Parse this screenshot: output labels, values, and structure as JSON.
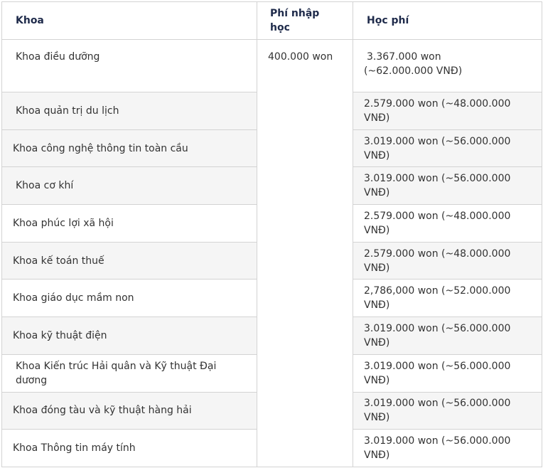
{
  "headers": {
    "khoa": "Khoa",
    "phi_nhap_hoc": "Phí nhập học",
    "hoc_phi": "Học phí"
  },
  "admission_fee": "400.000 won",
  "rows": [
    {
      "khoa": "Khoa điều dưỡng",
      "hoc_phi": "3.367.000 won",
      "hoc_phi_2": "(~62.000.000 VNĐ)"
    },
    {
      "khoa": "Khoa quản trị du lịch",
      "hoc_phi": "2.579.000 won (~48.000.000 VNĐ)"
    },
    {
      "khoa": "Khoa công nghệ thông tin toàn cầu",
      "hoc_phi": "3.019.000 won (~56.000.000 VNĐ)"
    },
    {
      "khoa": "Khoa cơ khí",
      "hoc_phi": "3.019.000 won (~56.000.000 VNĐ)"
    },
    {
      "khoa": "Khoa phúc lợi xã hội",
      "hoc_phi": "2.579.000 won (~48.000.000 VNĐ)"
    },
    {
      "khoa": "Khoa kế toán thuế",
      "hoc_phi": "2.579.000 won (~48.000.000 VNĐ)"
    },
    {
      "khoa": "Khoa giáo dục mầm non",
      "hoc_phi": "2,786,000 won (~52.000.000 VNĐ)"
    },
    {
      "khoa": "Khoa kỹ thuật điện",
      "hoc_phi": "3.019.000 won (~56.000.000 VNĐ)"
    },
    {
      "khoa": "Khoa Kiến trúc Hải quân và Kỹ thuật Đại dương",
      "hoc_phi": "3.019.000 won (~56.000.000 VNĐ)"
    },
    {
      "khoa": "Khoa đóng tàu và kỹ thuật hàng hải",
      "hoc_phi": "3.019.000 won (~56.000.000 VNĐ)"
    },
    {
      "khoa": "Khoa Thông tin máy tính",
      "hoc_phi": "3.019.000 won (~56.000.000 VNĐ)"
    }
  ]
}
